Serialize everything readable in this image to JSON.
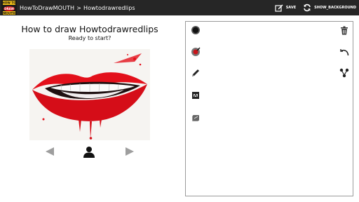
{
  "header": {
    "logo_text": [
      "HOW TO",
      "DRAW",
      "MOUTH"
    ],
    "app_name": "HowToDrawMOUTH",
    "separator": ">",
    "current_page": "Howtodrawredlips",
    "actions": [
      {
        "label": "SAVE",
        "icon": "edit-save-icon"
      },
      {
        "label": "SHOW_BACKGROUND",
        "icon": "sync-refresh-icon"
      }
    ]
  },
  "lesson": {
    "title": "How to draw Howtodrawredlips",
    "subtitle": "Ready to start?",
    "preview_image": "red-lips-illustration",
    "navigation": [
      "previous-arrow-icon",
      "person-icon",
      "next-arrow-icon"
    ]
  },
  "canvas": {
    "left_tools": [
      "brush-size-dot-icon",
      "color-palette-icon",
      "pencil-icon",
      "eraser-icon",
      "clear-layer-icon"
    ],
    "right_tools": [
      "trash-icon",
      "undo-icon",
      "share-icon"
    ]
  },
  "colors": {
    "topbar": "#262626",
    "accent_red": "#e3101b",
    "canvas_border": "#9a9a9a",
    "arrow_gray": "#9e9e9e"
  }
}
